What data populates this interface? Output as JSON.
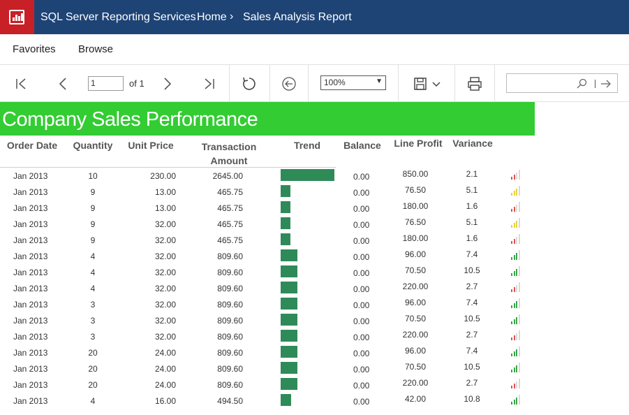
{
  "header": {
    "app_name": "SQL Server Reporting Services",
    "breadcrumb_home": "Home",
    "breadcrumb_sep": "›",
    "breadcrumb_current": "Sales Analysis Report"
  },
  "nav": {
    "favorites": "Favorites",
    "browse": "Browse"
  },
  "toolbar": {
    "page_value": "1",
    "of_label": "of 1",
    "zoom_value": "100%",
    "search_placeholder": ""
  },
  "report": {
    "title": "Company Sales Performance",
    "columns": {
      "order_date": "Order Date",
      "quantity": "Quantity",
      "unit_price": "Unit Price",
      "transaction_amount": "Transaction Amount",
      "trend": "Trend",
      "balance": "Balance",
      "line_profit": "Line Profit",
      "variance": "Variance"
    },
    "colors": {
      "trend_bar": "#2e8b57",
      "sig_red": "#e05252",
      "sig_yellow": "#e6d23c",
      "sig_green": "#3aa44a",
      "sig_empty": "#d9d9d9"
    },
    "rows": [
      {
        "date": "Jan 2013",
        "qty": "10",
        "price": "230.00",
        "amount": "2645.00",
        "trend": 1.0,
        "balance": "0.00",
        "profit": "850.00",
        "variance": "2.1",
        "signal": "red"
      },
      {
        "date": "Jan 2013",
        "qty": "9",
        "price": "13.00",
        "amount": "465.75",
        "trend": 0.18,
        "balance": "0.00",
        "profit": "76.50",
        "variance": "5.1",
        "signal": "yellow"
      },
      {
        "date": "Jan 2013",
        "qty": "9",
        "price": "13.00",
        "amount": "465.75",
        "trend": 0.18,
        "balance": "0.00",
        "profit": "180.00",
        "variance": "1.6",
        "signal": "red"
      },
      {
        "date": "Jan 2013",
        "qty": "9",
        "price": "32.00",
        "amount": "465.75",
        "trend": 0.18,
        "balance": "0.00",
        "profit": "76.50",
        "variance": "5.1",
        "signal": "yellow"
      },
      {
        "date": "Jan 2013",
        "qty": "9",
        "price": "32.00",
        "amount": "465.75",
        "trend": 0.18,
        "balance": "0.00",
        "profit": "180.00",
        "variance": "1.6",
        "signal": "red"
      },
      {
        "date": "Jan 2013",
        "qty": "4",
        "price": "32.00",
        "amount": "809.60",
        "trend": 0.31,
        "balance": "0.00",
        "profit": "96.00",
        "variance": "7.4",
        "signal": "green"
      },
      {
        "date": "Jan 2013",
        "qty": "4",
        "price": "32.00",
        "amount": "809.60",
        "trend": 0.31,
        "balance": "0.00",
        "profit": "70.50",
        "variance": "10.5",
        "signal": "green"
      },
      {
        "date": "Jan 2013",
        "qty": "4",
        "price": "32.00",
        "amount": "809.60",
        "trend": 0.31,
        "balance": "0.00",
        "profit": "220.00",
        "variance": "2.7",
        "signal": "red"
      },
      {
        "date": "Jan 2013",
        "qty": "3",
        "price": "32.00",
        "amount": "809.60",
        "trend": 0.31,
        "balance": "0.00",
        "profit": "96.00",
        "variance": "7.4",
        "signal": "green"
      },
      {
        "date": "Jan 2013",
        "qty": "3",
        "price": "32.00",
        "amount": "809.60",
        "trend": 0.31,
        "balance": "0.00",
        "profit": "70.50",
        "variance": "10.5",
        "signal": "green"
      },
      {
        "date": "Jan 2013",
        "qty": "3",
        "price": "32.00",
        "amount": "809.60",
        "trend": 0.31,
        "balance": "0.00",
        "profit": "220.00",
        "variance": "2.7",
        "signal": "red"
      },
      {
        "date": "Jan 2013",
        "qty": "20",
        "price": "24.00",
        "amount": "809.60",
        "trend": 0.31,
        "balance": "0.00",
        "profit": "96.00",
        "variance": "7.4",
        "signal": "green"
      },
      {
        "date": "Jan 2013",
        "qty": "20",
        "price": "24.00",
        "amount": "809.60",
        "trend": 0.31,
        "balance": "0.00",
        "profit": "70.50",
        "variance": "10.5",
        "signal": "green"
      },
      {
        "date": "Jan 2013",
        "qty": "20",
        "price": "24.00",
        "amount": "809.60",
        "trend": 0.31,
        "balance": "0.00",
        "profit": "220.00",
        "variance": "2.7",
        "signal": "red"
      },
      {
        "date": "Jan 2013",
        "qty": "4",
        "price": "16.00",
        "amount": "494.50",
        "trend": 0.19,
        "balance": "0.00",
        "profit": "42.00",
        "variance": "10.8",
        "signal": "green"
      }
    ]
  }
}
